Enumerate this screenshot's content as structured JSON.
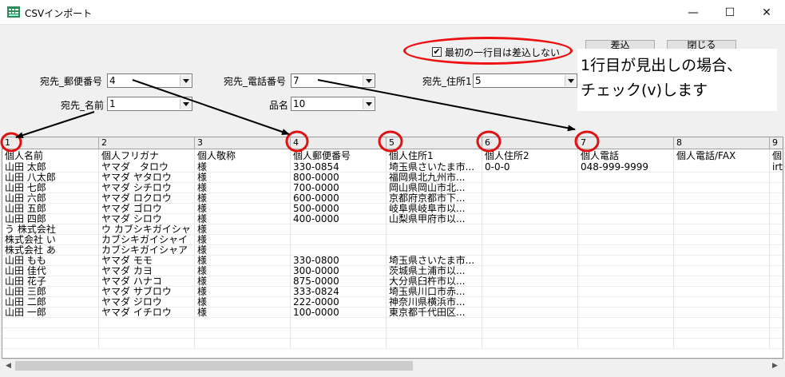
{
  "window": {
    "title": "CSVインポート",
    "minimize_glyph": "—",
    "maximize_glyph": "☐",
    "close_glyph": "✕"
  },
  "toolbar": {
    "import_label": "差込",
    "close_label": "閉じる"
  },
  "options": {
    "skip_header_checked_mark": "✔",
    "skip_header_label": "最初の一行目は差込しない"
  },
  "annotation": {
    "line1": "1行目が見出しの場合、",
    "line2": "チェック(v)します"
  },
  "mapping": {
    "postal_label": "宛先_郵便番号",
    "postal_value": "4",
    "phone_label": "宛先_電話番号",
    "phone_value": "7",
    "address_label": "宛先_住所1",
    "address_value": "5",
    "name_label": "宛先_名前",
    "name_value": "1",
    "product_label": "品名",
    "product_value": "10"
  },
  "grid": {
    "column_numbers": [
      "1",
      "2",
      "3",
      "4",
      "5",
      "6",
      "7",
      "8",
      "9"
    ],
    "headers": [
      "個人名前",
      "個人フリガナ",
      "個人敬称",
      "個人郵便番号",
      "個人住所1",
      "個人住所2",
      "個人電話",
      "個人電話/FAX",
      "個"
    ],
    "rows": [
      [
        "山田 太郎",
        "ヤマダ　タロウ",
        "様",
        "330-0854",
        "埼玉県さいたま市...",
        "0-0-0",
        "048-999-9999",
        "",
        "irt"
      ],
      [
        "山田 八太郎",
        "ヤマダ ヤタロウ",
        "様",
        "800-0000",
        "福岡県北九州市...",
        "",
        "",
        "",
        ""
      ],
      [
        "山田 七郎",
        "ヤマダ シチロウ",
        "様",
        "700-0000",
        "岡山県岡山市北...",
        "",
        "",
        "",
        ""
      ],
      [
        "山田 六郎",
        "ヤマダ ロクロウ",
        "様",
        "600-0000",
        "京都府京都市下...",
        "",
        "",
        "",
        ""
      ],
      [
        "山田 五郎",
        "ヤマダ ゴロウ",
        "様",
        "500-0000",
        "岐阜県岐阜市以...",
        "",
        "",
        "",
        ""
      ],
      [
        "山田 四郎",
        "ヤマダ シロウ",
        "様",
        "400-0000",
        "山梨県甲府市以...",
        "",
        "",
        "",
        ""
      ],
      [
        "う 株式会社",
        "ウ カブシキガイシャ",
        "様",
        "",
        "",
        "",
        "",
        "",
        ""
      ],
      [
        "株式会社 い",
        "カブシキガイシャイ",
        "様",
        "",
        "",
        "",
        "",
        "",
        ""
      ],
      [
        "株式会社 あ",
        "カブシキガイシャア",
        "様",
        "",
        "",
        "",
        "",
        "",
        ""
      ],
      [
        "山田 もも",
        "ヤマダ モモ",
        "様",
        "330-0800",
        "埼玉県さいたま市...",
        "",
        "",
        "",
        ""
      ],
      [
        "山田 佳代",
        "ヤマダ カヨ",
        "様",
        "300-0000",
        "茨城県土浦市以...",
        "",
        "",
        "",
        ""
      ],
      [
        "山田 花子",
        "ヤマダ ハナコ",
        "様",
        "875-0000",
        "大分県臼杵市以...",
        "",
        "",
        "",
        ""
      ],
      [
        "山田 三郎",
        "ヤマダ サブロウ",
        "様",
        "333-0824",
        "埼玉県川口市赤...",
        "",
        "",
        "",
        ""
      ],
      [
        "山田 二郎",
        "ヤマダ ジロウ",
        "様",
        "222-0000",
        "神奈川県横浜市...",
        "",
        "",
        "",
        ""
      ],
      [
        "山田 一郎",
        "ヤマダ イチロウ",
        "様",
        "100-0000",
        "東京都千代田区...",
        "",
        "",
        "",
        ""
      ]
    ]
  },
  "colors": {
    "annotation_red": "#e11111",
    "arrow_black": "#000000"
  }
}
